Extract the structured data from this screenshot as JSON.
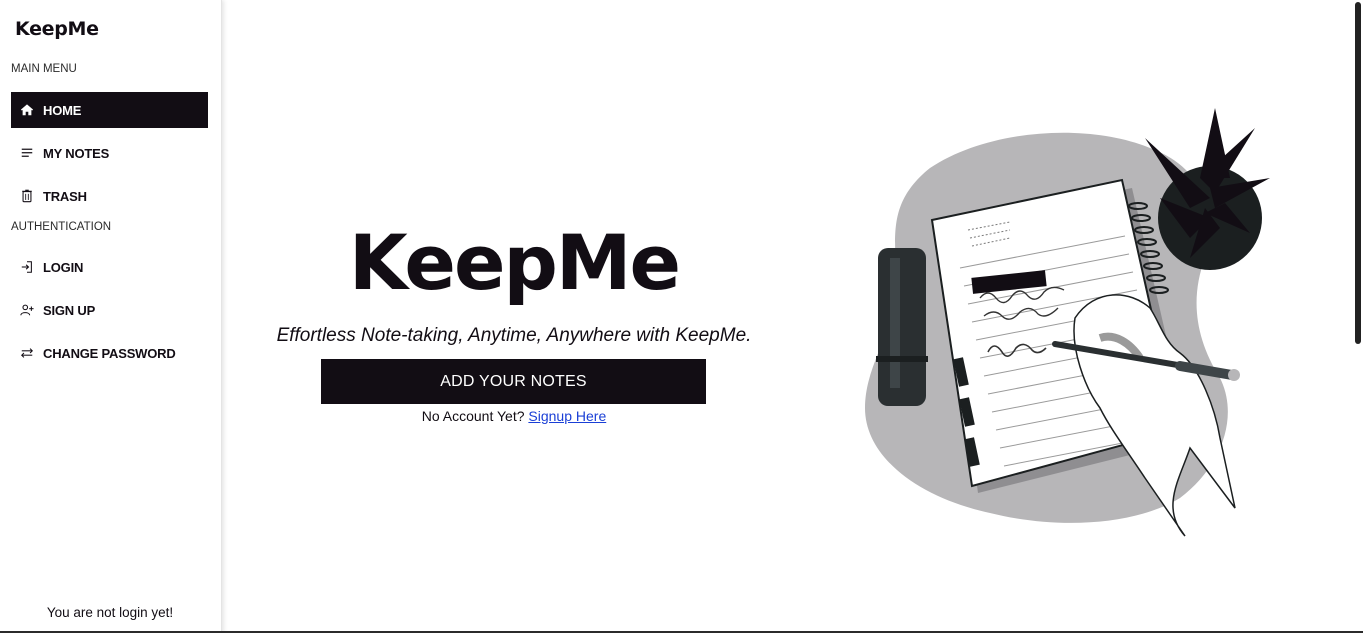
{
  "app": {
    "brand": "KeepMe"
  },
  "sidebar": {
    "sections": [
      {
        "label": "MAIN MENU"
      },
      {
        "label": "AUTHENTICATION"
      }
    ],
    "main_items": [
      {
        "label": "HOME",
        "icon": "home-icon",
        "active": true
      },
      {
        "label": "MY NOTES",
        "icon": "notes-lines-icon",
        "active": false
      },
      {
        "label": "TRASH",
        "icon": "trash-icon",
        "active": false
      }
    ],
    "auth_items": [
      {
        "label": "LOGIN",
        "icon": "login-icon"
      },
      {
        "label": "SIGN UP",
        "icon": "user-plus-icon"
      },
      {
        "label": "CHANGE PASSWORD",
        "icon": "swap-arrows-icon"
      }
    ],
    "status": "You are not login yet!"
  },
  "hero": {
    "title": "KeepMe",
    "subtitle": "Effortless Note-taking, Anytime, Anywhere with KeepMe.",
    "cta_label": "ADD YOUR NOTES",
    "signup_prompt": "No Account Yet?",
    "signup_link": "Signup Here"
  },
  "colors": {
    "primary": "#120d14",
    "link": "#1a3fd6",
    "illustration_blob": "#b7b6b8"
  }
}
